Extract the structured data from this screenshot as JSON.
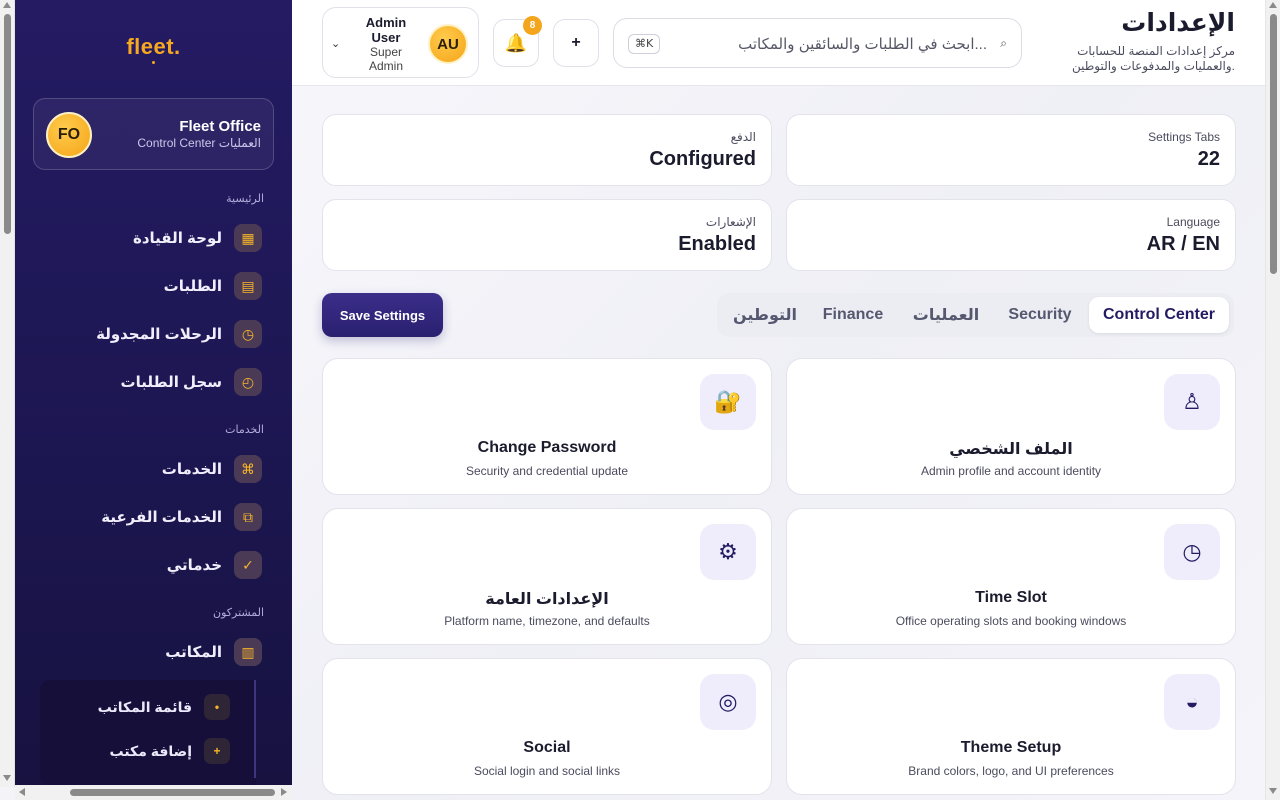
{
  "sidebar": {
    "logo": "fleet.",
    "office": {
      "avatar": "FO",
      "name": "Fleet Office",
      "subtitle": "Control Center العمليات"
    },
    "sections": {
      "main": "الرئيسية",
      "services": "الخدمات",
      "subscribers": "المشتركون"
    },
    "items": [
      {
        "label": "لوحة القيادة",
        "icon": "▦"
      },
      {
        "label": "الطلبات",
        "icon": "▤"
      },
      {
        "label": "الرحلات المجدولة",
        "icon": "◷"
      },
      {
        "label": "سجل الطلبات",
        "icon": "◴"
      },
      {
        "label": "الخدمات",
        "icon": "⌘"
      },
      {
        "label": "الخدمات الفرعية",
        "icon": "⧉"
      },
      {
        "label": "خدماتي",
        "icon": "✓"
      },
      {
        "label": "المكاتب",
        "icon": "▥"
      }
    ],
    "subitems": [
      {
        "label": "قائمة المكاتب",
        "icon": "•"
      },
      {
        "label": "إضافة مكتب",
        "icon": "+"
      }
    ]
  },
  "header": {
    "title": "الإعدادات",
    "subtitle": "مركز إعدادات المنصة للحسابات والعمليات والمدفوعات والتوطين.",
    "search_placeholder": "ابحث في الطلبات والسائقين والمكاتب...",
    "search_shortcut": "⌘K",
    "add_label": "+",
    "notification_count": "8",
    "user": {
      "avatar": "AU",
      "name": "Admin User",
      "role": "Super Admin"
    }
  },
  "stats": [
    {
      "label": "Settings Tabs",
      "value": "22"
    },
    {
      "label": "الدفع",
      "value": "Configured"
    },
    {
      "label": "Language",
      "value": "AR / EN"
    },
    {
      "label": "الإشعارات",
      "value": "Enabled"
    }
  ],
  "tabs": [
    {
      "label": "Control Center",
      "active": true
    },
    {
      "label": "Security",
      "active": false
    },
    {
      "label": "العمليات",
      "active": false
    },
    {
      "label": "Finance",
      "active": false
    },
    {
      "label": "التوطين",
      "active": false
    }
  ],
  "save_label": "Save Settings",
  "cards": [
    {
      "title": "الملف الشخصي",
      "desc": "Admin profile and account identity",
      "icon": "user-icon"
    },
    {
      "title": "Change Password",
      "desc": "Security and credential update",
      "icon": "lock-icon"
    },
    {
      "title": "Time Slot",
      "desc": "Office operating slots and booking windows",
      "icon": "clock-icon"
    },
    {
      "title": "الإعدادات العامة",
      "desc": "Platform name, timezone, and defaults",
      "icon": "gear-icon"
    },
    {
      "title": "Theme Setup",
      "desc": "Brand colors, logo, and UI preferences",
      "icon": "theme-icon"
    },
    {
      "title": "Social",
      "desc": "Social login and social links",
      "icon": "social-icon"
    }
  ],
  "colors": {
    "sidebar": "#241b63",
    "accent": "#f6a821",
    "primary": "#2a2070"
  }
}
